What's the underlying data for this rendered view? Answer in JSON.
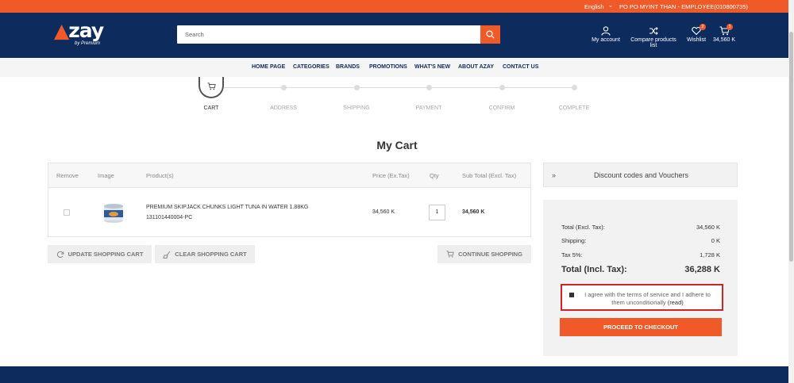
{
  "topbar": {
    "language": "English",
    "user": "PO PO MYINT THAN - EMPLOYEE(010800735)"
  },
  "header": {
    "logo_text": "zay",
    "logo_byline": "by Premium",
    "search_placeholder": "Search",
    "account_label": "My account",
    "compare_label": "Compare products list",
    "wishlist_label": "Wishlist",
    "wishlist_count": "2",
    "cart_count": "1",
    "cart_total": "34,560 K"
  },
  "nav": {
    "items": [
      "HOME PAGE",
      "CATEGORIES",
      "BRANDS",
      "PROMOTIONS",
      "WHAT'S NEW",
      "ABOUT AZAY",
      "CONTACT US"
    ]
  },
  "steps": [
    "CART",
    "ADDRESS",
    "SHIPPING",
    "PAYMENT",
    "CONFIRM",
    "COMPLETE"
  ],
  "page_title": "My Cart",
  "cart": {
    "columns": [
      "Remove",
      "Image",
      "Product(s)",
      "Price (Ex.Tax)",
      "Qty",
      "Sub Total (Excl. Tax)"
    ],
    "rows": [
      {
        "name": "PREMIUM SKIPJACK CHUNKS LIGHT TUNA IN WATER 1.88KG",
        "sku": "131101440004-PC",
        "price": "34,560 K",
        "qty": "1",
        "subtotal": "34,560 K"
      }
    ],
    "update_label": "UPDATE SHOPPING CART",
    "clear_label": "CLEAR SHOPPING CART",
    "continue_label": "CONTINUE SHOPPING"
  },
  "discount_label": "Discount codes and Vouchers",
  "totals": {
    "subtotal_label": "Total (Excl. Tax):",
    "subtotal_value": "34,560 K",
    "shipping_label": "Shipping:",
    "shipping_value": "0 K",
    "tax_label": "Tax 5%:",
    "tax_value": "1,728 K",
    "total_label": "Total (Incl. Tax):",
    "total_value": "36,288 K",
    "terms_text": "I agree with the terms of service and I adhere to them unconditionally",
    "terms_link": "(read)",
    "checkout_label": "PROCEED TO CHECKOUT"
  },
  "colors": {
    "brand_orange": "#f05a28",
    "brand_navy": "#0d2b5c",
    "highlight_red": "#d2232a"
  }
}
